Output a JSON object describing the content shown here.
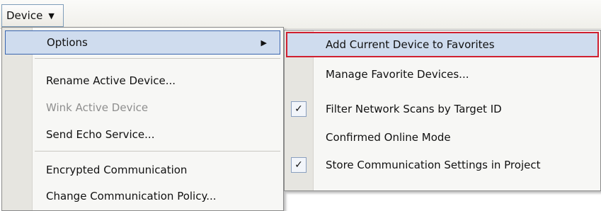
{
  "menubar": {
    "device_label": "Device",
    "chevron": "chevron-down-icon"
  },
  "main_menu": {
    "items": [
      {
        "label": "Options",
        "has_submenu": true
      },
      {
        "label": "Rename Active Device..."
      },
      {
        "label": "Wink Active Device",
        "disabled": true
      },
      {
        "label": "Send Echo Service..."
      },
      {
        "label": "Encrypted Communication"
      },
      {
        "label": "Change Communication Policy..."
      }
    ]
  },
  "options_submenu": {
    "items": [
      {
        "label": "Add Current Device to Favorites",
        "highlighted": true
      },
      {
        "label": "Manage Favorite Devices..."
      },
      {
        "label": "Filter Network Scans by Target ID",
        "checked": true
      },
      {
        "label": "Confirmed Online Mode"
      },
      {
        "label": "Store Communication Settings in Project",
        "checked": true
      }
    ]
  },
  "colors": {
    "highlight_bg": "#cfdcee",
    "highlight_border": "#3a66b0",
    "focus_outline": "#d02030"
  }
}
